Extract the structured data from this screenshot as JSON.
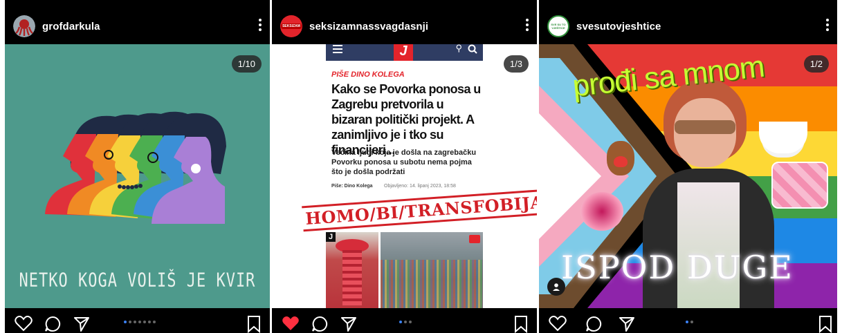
{
  "posts": [
    {
      "username": "grofdarkula",
      "counter": "1/10",
      "caption": "NETKO KOGA VOLIŠ JE KVIR",
      "liked": false,
      "dots_total": 7,
      "dots_active": 0,
      "avatar_icon": "octopus-avatar-icon"
    },
    {
      "username": "seksizamnassvagdasnji",
      "counter": "1/3",
      "avatar_label": "SEKSIZAM",
      "liked": true,
      "dots_total": 3,
      "dots_active": 0,
      "article": {
        "logo": "J",
        "kicker": "PIŠE DINO KOLEGA",
        "headline": "Kako se Povorka ponosa u Zagrebu pretvorila u bizaran politički projekt. A zanimljivo je i tko su financijeri...",
        "lead": "Većina ljudi koja je došla na zagrebačku Povorku ponosa u subotu nema pojma što je došla podržati",
        "author": "Piše: Dino Kolega",
        "published": "Objavljeno: 14. lipanj 2023, 18:58",
        "stamp": "HOMO/BI/TRANSFOBIJA",
        "photo_badge": "J"
      }
    },
    {
      "username": "svesutovjeshtice",
      "counter": "1/2",
      "avatar_label": "SVE SU TO VJEŠTICE",
      "liked": false,
      "dots_total": 2,
      "dots_active": 0,
      "overlay_top": "prođi sa mnom",
      "overlay_bottom": "ISPOD DUGE"
    }
  ],
  "colors": {
    "like_red": "#ff3040",
    "dot_active": "#3b82f6",
    "teal_bg": "#4e9a8c",
    "article_red": "#e3242b"
  }
}
